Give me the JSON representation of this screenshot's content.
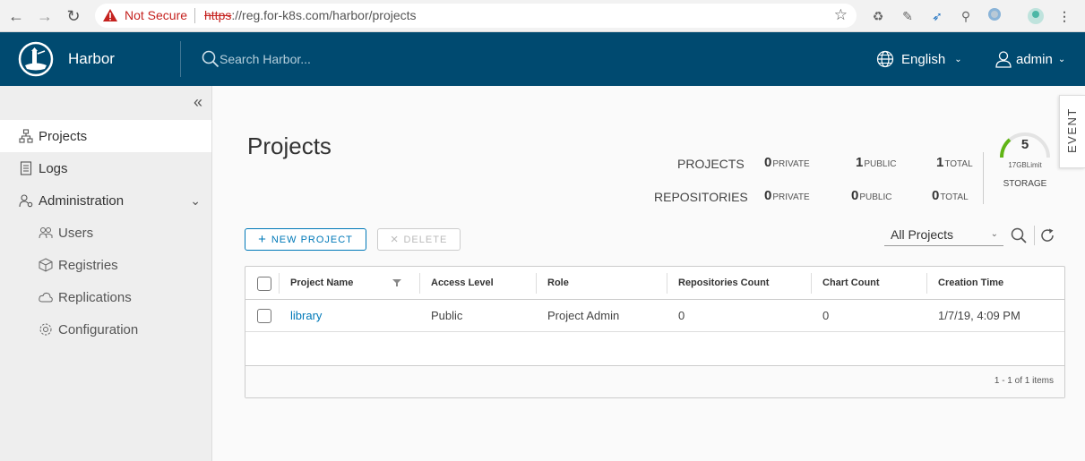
{
  "browser": {
    "not_secure": "Not Secure",
    "url_scheme": "https",
    "url_rest": "://reg.for-k8s.com/harbor/projects"
  },
  "header": {
    "brand": "Harbor",
    "search_placeholder": "Search Harbor...",
    "language": "English",
    "user": "admin",
    "bg_color": "#004a70"
  },
  "sidebar": {
    "items": [
      {
        "label": "Projects",
        "icon": "projects-icon"
      },
      {
        "label": "Logs",
        "icon": "logs-icon"
      },
      {
        "label": "Administration",
        "icon": "administration-icon"
      }
    ],
    "admin_items": [
      {
        "label": "Users",
        "icon": "users-icon"
      },
      {
        "label": "Registries",
        "icon": "registries-icon"
      },
      {
        "label": "Replications",
        "icon": "replications-icon"
      },
      {
        "label": "Configuration",
        "icon": "configuration-icon"
      }
    ]
  },
  "main": {
    "title": "Projects",
    "stats": {
      "projects_label": "PROJECTS",
      "repositories_label": "REPOSITORIES",
      "projects_private": "0",
      "projects_public": "1",
      "projects_total": "1",
      "repos_private": "0",
      "repos_public": "0",
      "repos_total": "0",
      "private_unit": "PRIVATE",
      "public_unit": "PUBLIC",
      "total_unit": "TOTAL"
    },
    "storage": {
      "value": "5",
      "limit": "17GBLimit",
      "label": "STORAGE"
    },
    "event_tab": "EVENT",
    "new_project_label": "NEW PROJECT",
    "delete_label": "DELETE",
    "filter_value": "All Projects",
    "grid": {
      "columns": [
        "Project Name",
        "Access Level",
        "Role",
        "Repositories Count",
        "Chart Count",
        "Creation Time"
      ],
      "rows": [
        {
          "name": "library",
          "access": "Public",
          "role": "Project Admin",
          "repos": "0",
          "charts": "0",
          "created": "1/7/19, 4:09 PM"
        }
      ],
      "footer": "1 - 1 of 1 items"
    }
  },
  "colors": {
    "accent": "#0079b8",
    "warning": "#c5221f"
  }
}
